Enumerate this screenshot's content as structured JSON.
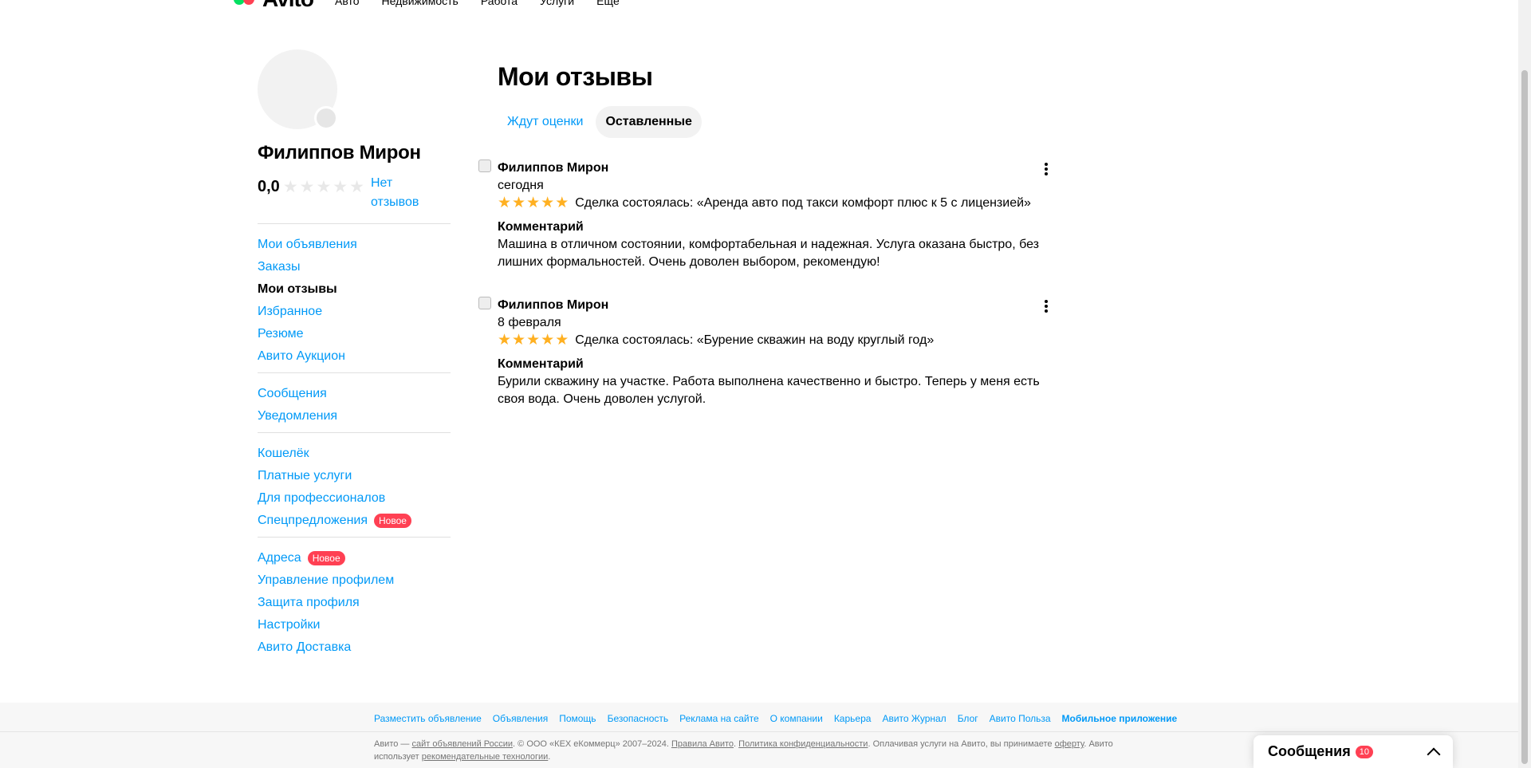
{
  "topnav": {
    "logo": "Avito",
    "links": [
      "Авто",
      "Недвижимость",
      "Работа",
      "Услуги",
      "Ещё"
    ]
  },
  "profile": {
    "name": "Филиппов Мирон",
    "rating": "0,0",
    "stars_filled": 0,
    "stars_total": 5,
    "no_reviews": "Нет отзывов"
  },
  "sidebar": {
    "groups": [
      [
        {
          "label": "Мои объявления",
          "active": false
        },
        {
          "label": "Заказы",
          "active": false
        },
        {
          "label": "Мои отзывы",
          "active": true
        },
        {
          "label": "Избранное",
          "active": false
        },
        {
          "label": "Резюме",
          "active": false
        },
        {
          "label": "Авито Аукцион",
          "active": false
        }
      ],
      [
        {
          "label": "Сообщения",
          "active": false
        },
        {
          "label": "Уведомления",
          "active": false
        }
      ],
      [
        {
          "label": "Кошелёк",
          "active": false
        },
        {
          "label": "Платные услуги",
          "active": false
        },
        {
          "label": "Для профессионалов",
          "active": false
        },
        {
          "label": "Спецпредложения",
          "active": false,
          "badge": "Новое"
        }
      ],
      [
        {
          "label": "Адреса",
          "active": false,
          "badge": "Новое"
        },
        {
          "label": "Управление профилем",
          "active": false
        },
        {
          "label": "Защита профиля",
          "active": false
        },
        {
          "label": "Настройки",
          "active": false
        },
        {
          "label": "Авито Доставка",
          "active": false
        }
      ]
    ]
  },
  "main": {
    "title": "Мои отзывы",
    "tabs": [
      {
        "label": "Ждут оценки",
        "selected": false
      },
      {
        "label": "Оставленные",
        "selected": true
      }
    ],
    "reviews": [
      {
        "author": "Филиппов Мирон",
        "date": "сегодня",
        "stars": 5,
        "deal": "Сделка состоялась: «Аренда авто под такси комфорт плюс к 5 с лицензией»",
        "comment_title": "Комментарий",
        "comment": "Машина в отличном состоянии, комфортабельная и надежная. Услуга оказана быстро, без лишних формальностей. Очень доволен выбором, рекомендую!"
      },
      {
        "author": "Филиппов Мирон",
        "date": "8 февраля",
        "stars": 5,
        "deal": "Сделка состоялась: «Бурение скважин на воду круглый год»",
        "comment_title": "Комментарий",
        "comment": "Бурили скважину на участке. Работа выполнена качественно и быстро. Теперь у меня есть своя вода. Очень доволен услугой."
      }
    ]
  },
  "footer": {
    "links": [
      "Разместить объявление",
      "Объявления",
      "Помощь",
      "Безопасность",
      "Реклама на сайте",
      "О компании",
      "Карьера",
      "Авито Журнал",
      "Блог",
      "Авито Польза"
    ],
    "app_link": "Мобильное приложение",
    "legal": {
      "p1": "Авито — ",
      "link1": "сайт объявлений России",
      "p2": ". © ООО «КЕХ eКоммерц» 2007–2024. ",
      "link2": "Правила Авито",
      "p3": ". ",
      "link3": "Политика конфиденциальности",
      "p4": ". Оплачивая услуги на Авито, вы принимаете ",
      "link4": "оферту",
      "p5": ". Авито использует ",
      "link5": "рекомендательные технологии",
      "p6": "."
    }
  },
  "messages_widget": {
    "title": "Сообщения",
    "count": "10"
  },
  "colors": {
    "link": "#0099f7",
    "badge": "#ff4053",
    "star": "#ffb021",
    "star_empty": "#e8e8e8"
  },
  "icons": [
    "kebab-menu-icon",
    "chevron-up-icon",
    "star-icon"
  ]
}
